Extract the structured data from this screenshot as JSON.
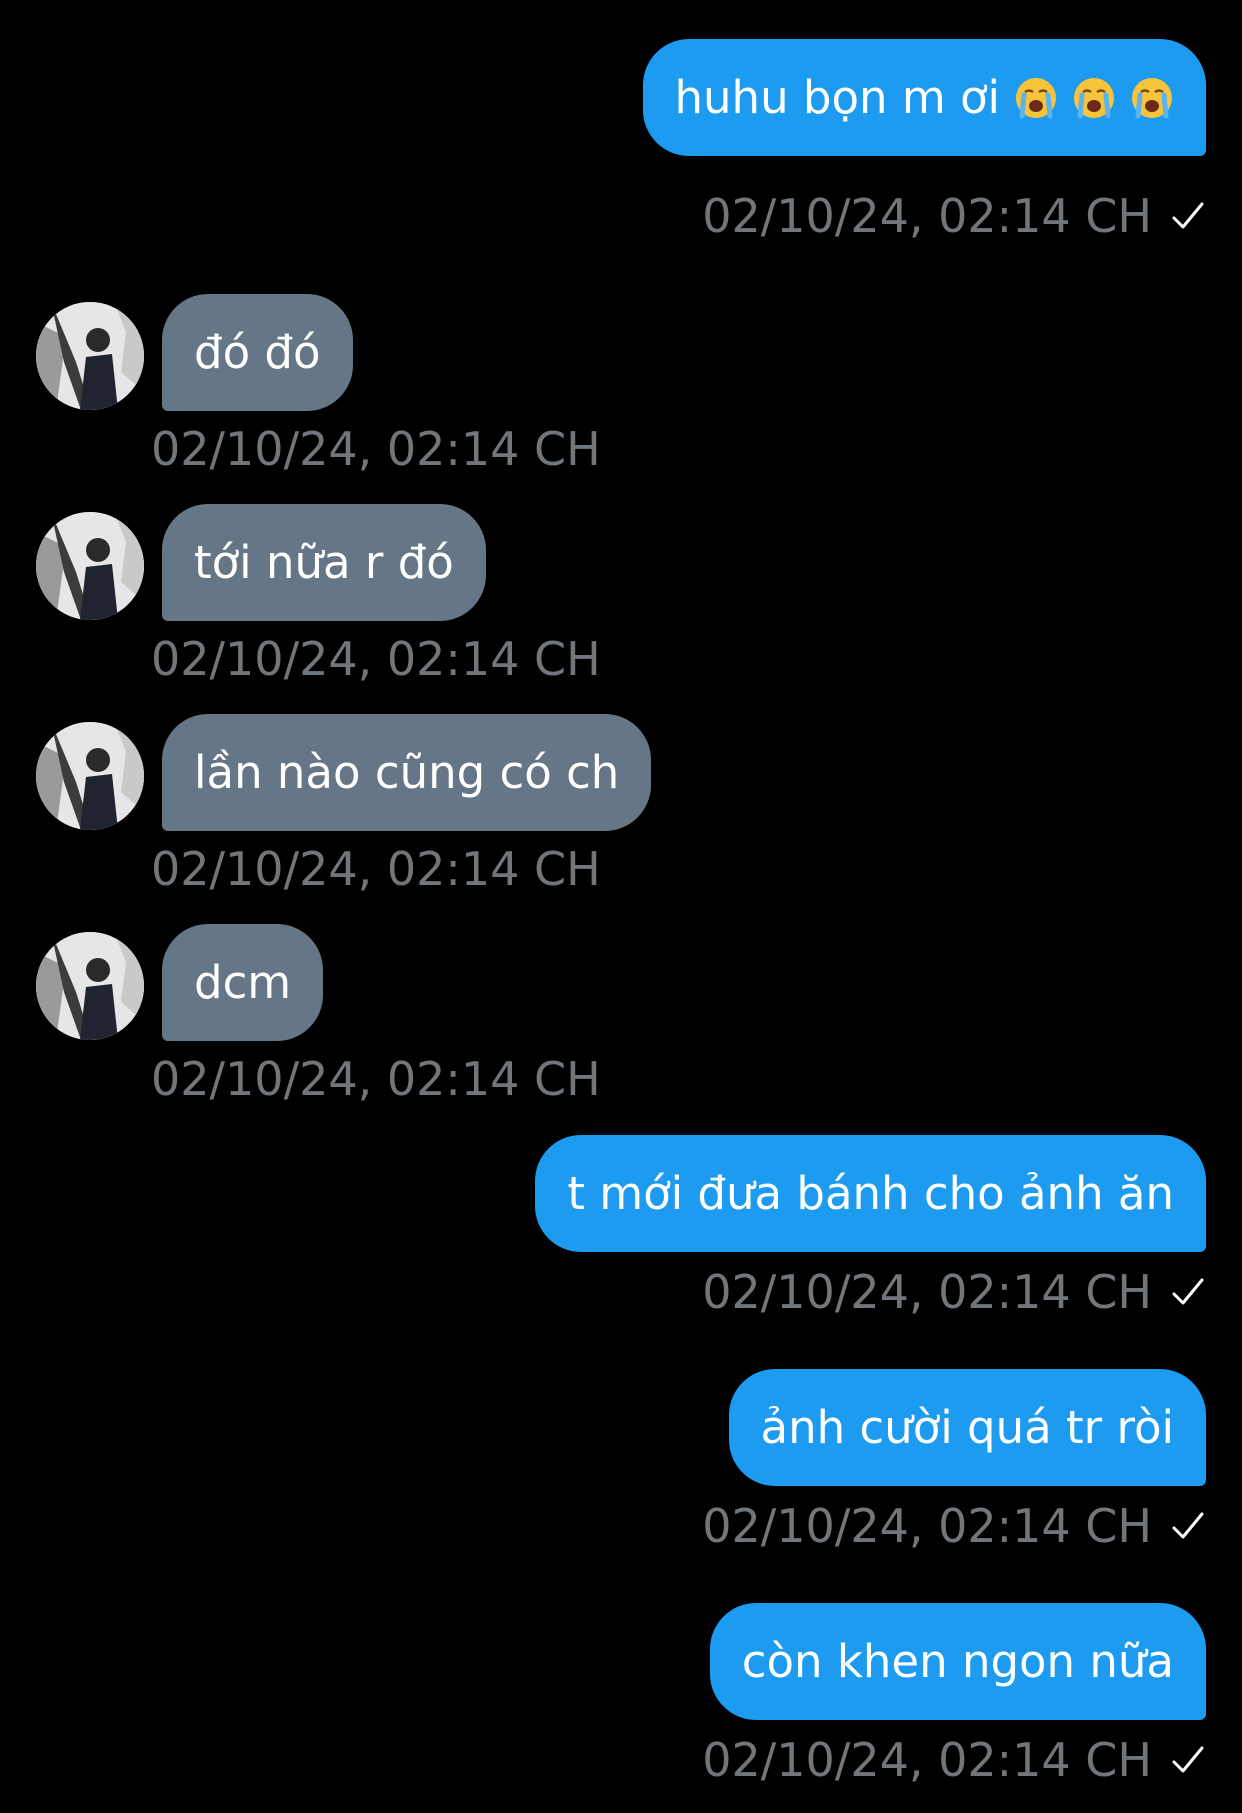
{
  "conversation": {
    "messages": [
      {
        "direction": "out",
        "text": "huhu bọn m ơi",
        "emoji_icons": [
          "loudly-crying-face-icon",
          "loudly-crying-face-icon",
          "loudly-crying-face-icon"
        ],
        "timestamp": "02/10/24, 02:14 CH",
        "read_status": "sent-check"
      },
      {
        "direction": "in",
        "text": "đó đó",
        "timestamp": "02/10/24, 02:14 CH"
      },
      {
        "direction": "in",
        "text": "tới nữa r đó",
        "timestamp": "02/10/24, 02:14 CH"
      },
      {
        "direction": "in",
        "text": "lần nào cũng có ch",
        "timestamp": "02/10/24, 02:14 CH"
      },
      {
        "direction": "in",
        "text": "dcm",
        "timestamp": "02/10/24, 02:14 CH"
      },
      {
        "direction": "out",
        "text": "t mới đưa bánh cho ảnh ăn",
        "timestamp": "02/10/24, 02:14 CH",
        "read_status": "sent-check"
      },
      {
        "direction": "out",
        "text": "ảnh cười quá tr ròi",
        "timestamp": "02/10/24, 02:14 CH",
        "read_status": "sent-check"
      },
      {
        "direction": "out",
        "text": "còn khen ngon nữa",
        "timestamp": "02/10/24, 02:14 CH",
        "read_status": "sent-check"
      }
    ]
  },
  "colors": {
    "background": "#000000",
    "outgoing_bubble": "#1d9bf0",
    "incoming_bubble": "#657786",
    "timestamp_text": "#71767b",
    "message_text": "#ffffff"
  }
}
